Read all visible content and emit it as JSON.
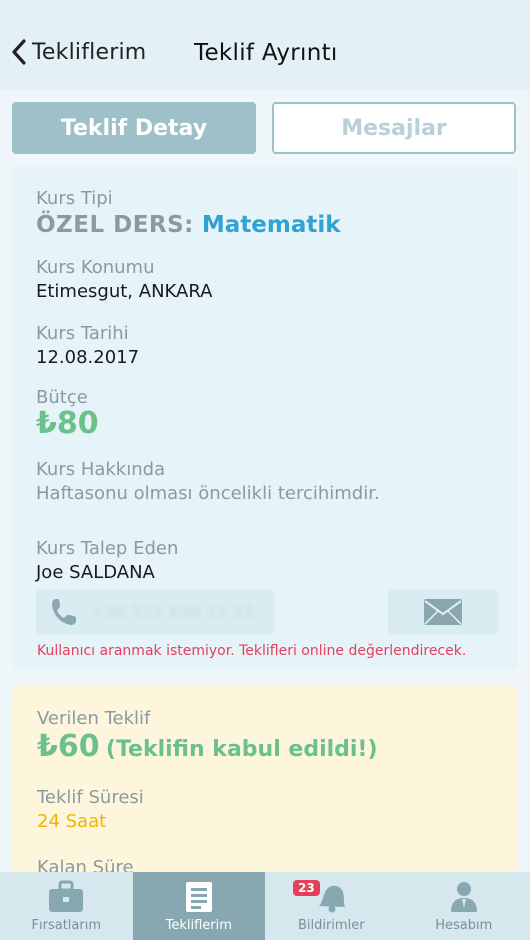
{
  "header": {
    "back_label": "Tekliflerim",
    "title": "Teklif Ayrıntı"
  },
  "tabs": [
    {
      "label": "Teklif Detay",
      "active": true
    },
    {
      "label": "Mesajlar",
      "active": false
    }
  ],
  "course": {
    "type_label": "Kurs Tipi",
    "type_main": "ÖZEL DERS:",
    "type_sub": "Matematik",
    "location_label": "Kurs Konumu",
    "location": "Etimesgut, ANKARA",
    "date_label": "Kurs Tarihi",
    "date": "12.08.2017",
    "budget_label": "Bütçe",
    "budget": "₺80",
    "about_label": "Kurs Hakkında",
    "about": "Haftasonu olması öncelikli tercihimdir.",
    "requester_label": "Kurs Talep Eden",
    "requester": "Joe SALDANA",
    "phone": "+90 555 658 22 11",
    "contact_warning": "Kullanıcı aranmak istemiyor. Teklifleri online değerlendirecek."
  },
  "offer": {
    "given_label": "Verilen Teklif",
    "given_amount": "₺60",
    "given_status": "(Teklifin kabul edildi!)",
    "duration_label": "Teklif Süresi",
    "duration": "24 Saat",
    "remaining_label": "Kalan Süre"
  },
  "tabbar": {
    "items": [
      {
        "label": "Fırsatlarım",
        "icon": "briefcase-icon"
      },
      {
        "label": "Tekliflerim",
        "icon": "document-icon",
        "active": true
      },
      {
        "label": "Bildirimler",
        "icon": "bell-icon",
        "badge": "23"
      },
      {
        "label": "Hesabım",
        "icon": "person-icon"
      }
    ]
  },
  "colors": {
    "accent": "#9ec0c8",
    "link": "#2fa3d3",
    "price": "#6cc08a",
    "warning": "#e4405a",
    "duration": "#f0b400"
  }
}
